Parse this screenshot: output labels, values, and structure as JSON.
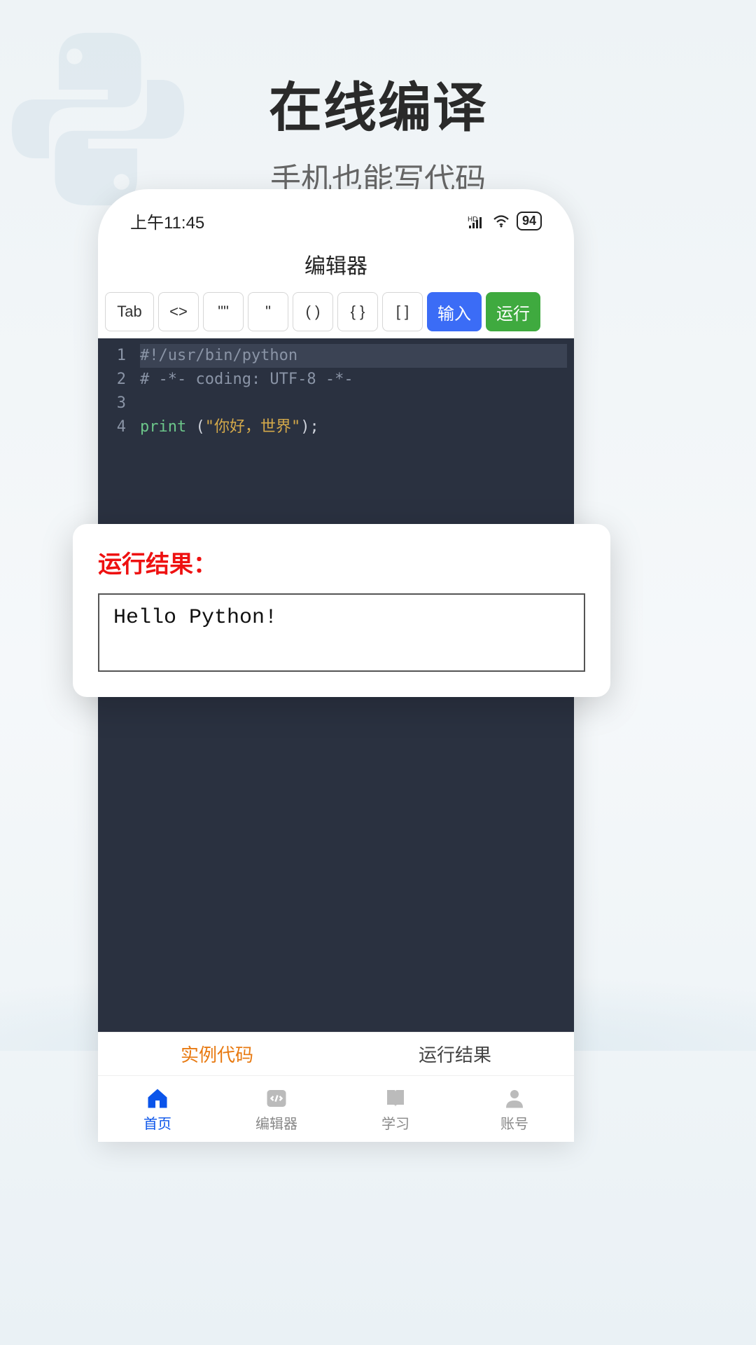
{
  "hero": {
    "title": "在线编译",
    "subtitle": "手机也能写代码"
  },
  "statusbar": {
    "time": "上午11:45",
    "battery": "94"
  },
  "app": {
    "title": "编辑器"
  },
  "toolbar": {
    "tab": "Tab",
    "angle": "<>",
    "dquote": "\"\"",
    "squote": "\"",
    "paren": "( )",
    "brace": "{ }",
    "bracket": "[ ]",
    "input": "输入",
    "run": "运行"
  },
  "editor": {
    "lines": [
      "1",
      "2",
      "3",
      "4"
    ],
    "line1": "#!/usr/bin/python",
    "line2": "# -*- coding: UTF-8 -*-",
    "line4_key": "print",
    "line4_paren_open": " (",
    "line4_str": "\"你好，世界\"",
    "line4_paren_close": ");"
  },
  "result": {
    "title": "运行结果：",
    "output": "Hello Python!"
  },
  "bottom_tabs": {
    "example": "实例代码",
    "result": "运行结果"
  },
  "nav": {
    "home": "首页",
    "editor": "编辑器",
    "learn": "学习",
    "account": "账号"
  }
}
